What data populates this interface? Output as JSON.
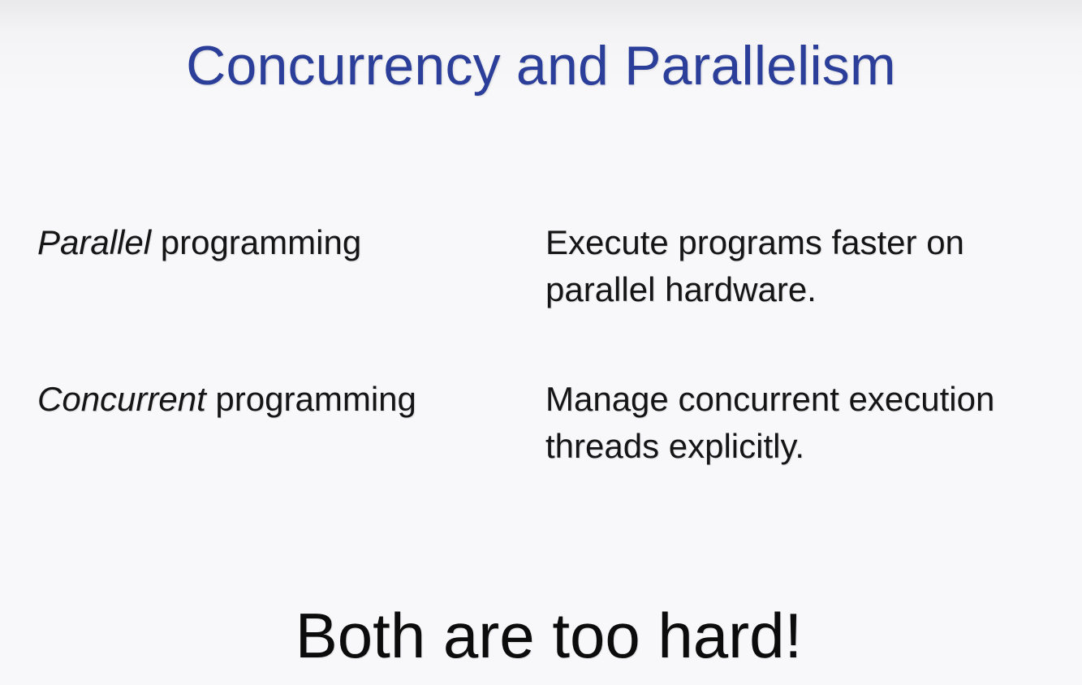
{
  "title": "Concurrency and Parallelism",
  "rows": [
    {
      "term_emph": "Parallel",
      "term_rest": " programming",
      "desc_lines": [
        "Execute programs faster on",
        "parallel hardware."
      ]
    },
    {
      "term_emph": "Concurrent",
      "term_rest": " programming",
      "desc_lines": [
        "Manage concurrent execution",
        "threads explicitly."
      ]
    }
  ],
  "footer": "Both are too hard!",
  "colors": {
    "title": "#2b3f9a",
    "text": "#151515",
    "background": "#f8f8fa"
  }
}
